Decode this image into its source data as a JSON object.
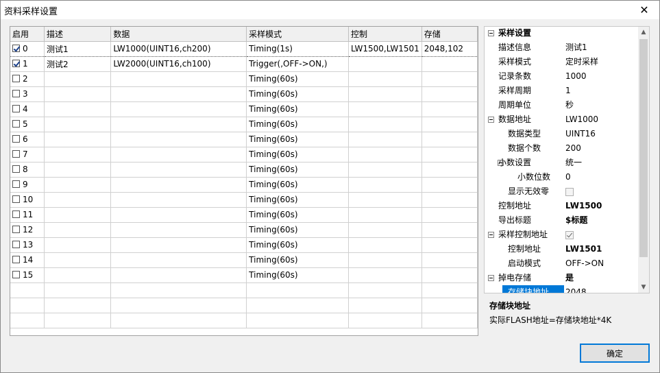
{
  "window": {
    "title": "资料采样设置",
    "close_glyph": "✕"
  },
  "grid": {
    "columns": [
      "启用",
      "描述",
      "数据",
      "采样模式",
      "控制",
      "存储"
    ],
    "rows": [
      {
        "enabled": true,
        "index": "0",
        "desc": "测试1",
        "data": "LW1000(UINT16,ch200)",
        "mode": "Timing(1s)",
        "control": "LW1500,LW1501",
        "storage": "2048,102"
      },
      {
        "enabled": true,
        "index": "1",
        "desc": "测试2",
        "data": "LW2000(UINT16,ch100)",
        "mode": "Trigger(,OFF->ON,)",
        "control": "",
        "storage": ""
      },
      {
        "enabled": false,
        "index": "2",
        "desc": "",
        "data": "",
        "mode": "Timing(60s)",
        "control": "",
        "storage": ""
      },
      {
        "enabled": false,
        "index": "3",
        "desc": "",
        "data": "",
        "mode": "Timing(60s)",
        "control": "",
        "storage": ""
      },
      {
        "enabled": false,
        "index": "4",
        "desc": "",
        "data": "",
        "mode": "Timing(60s)",
        "control": "",
        "storage": ""
      },
      {
        "enabled": false,
        "index": "5",
        "desc": "",
        "data": "",
        "mode": "Timing(60s)",
        "control": "",
        "storage": ""
      },
      {
        "enabled": false,
        "index": "6",
        "desc": "",
        "data": "",
        "mode": "Timing(60s)",
        "control": "",
        "storage": ""
      },
      {
        "enabled": false,
        "index": "7",
        "desc": "",
        "data": "",
        "mode": "Timing(60s)",
        "control": "",
        "storage": ""
      },
      {
        "enabled": false,
        "index": "8",
        "desc": "",
        "data": "",
        "mode": "Timing(60s)",
        "control": "",
        "storage": ""
      },
      {
        "enabled": false,
        "index": "9",
        "desc": "",
        "data": "",
        "mode": "Timing(60s)",
        "control": "",
        "storage": ""
      },
      {
        "enabled": false,
        "index": "10",
        "desc": "",
        "data": "",
        "mode": "Timing(60s)",
        "control": "",
        "storage": ""
      },
      {
        "enabled": false,
        "index": "11",
        "desc": "",
        "data": "",
        "mode": "Timing(60s)",
        "control": "",
        "storage": ""
      },
      {
        "enabled": false,
        "index": "12",
        "desc": "",
        "data": "",
        "mode": "Timing(60s)",
        "control": "",
        "storage": ""
      },
      {
        "enabled": false,
        "index": "13",
        "desc": "",
        "data": "",
        "mode": "Timing(60s)",
        "control": "",
        "storage": ""
      },
      {
        "enabled": false,
        "index": "14",
        "desc": "",
        "data": "",
        "mode": "Timing(60s)",
        "control": "",
        "storage": ""
      },
      {
        "enabled": false,
        "index": "15",
        "desc": "",
        "data": "",
        "mode": "Timing(60s)",
        "control": "",
        "storage": ""
      }
    ]
  },
  "properties": [
    {
      "name": "采样设置",
      "value": "",
      "level": 0,
      "category": true,
      "bold": true
    },
    {
      "name": "描述信息",
      "value": "测试1",
      "level": 1
    },
    {
      "name": "采样模式",
      "value": "定时采样",
      "level": 1
    },
    {
      "name": "记录条数",
      "value": "1000",
      "level": 1
    },
    {
      "name": "采样周期",
      "value": "1",
      "level": 1
    },
    {
      "name": "周期单位",
      "value": "秒",
      "level": 1
    },
    {
      "name": "数据地址",
      "value": "LW1000",
      "level": 0,
      "category": true
    },
    {
      "name": "数据类型",
      "value": "UINT16",
      "level": 2
    },
    {
      "name": "数据个数",
      "value": "200",
      "level": 2
    },
    {
      "name": "小数设置",
      "value": "统一",
      "level": 1,
      "category": true
    },
    {
      "name": "小数位数",
      "value": "0",
      "level": 3
    },
    {
      "name": "显示无效零",
      "value": "",
      "level": 2,
      "checkbox": "off"
    },
    {
      "name": "控制地址",
      "value": "LW1500",
      "level": 1,
      "bold_value": true
    },
    {
      "name": "导出标题",
      "value": "$标题",
      "level": 1,
      "bold_value": true
    },
    {
      "name": "采样控制地址",
      "value": "",
      "level": 0,
      "category": true,
      "checkbox": "on"
    },
    {
      "name": "控制地址",
      "value": "LW1501",
      "level": 2,
      "bold_value": true
    },
    {
      "name": "启动模式",
      "value": "OFF->ON",
      "level": 2
    },
    {
      "name": "掉电存储",
      "value": "是",
      "level": 0,
      "category": true,
      "bold_value": true
    },
    {
      "name": "存储块地址",
      "value": "2048",
      "level": 2,
      "highlight": true
    }
  ],
  "description": {
    "title": "存储块地址",
    "text": "实际FLASH地址=存储块地址*4K"
  },
  "buttons": {
    "ok": "确定"
  },
  "colors": {
    "selection": "#0078d7",
    "default_button_border": "#0078d7"
  }
}
